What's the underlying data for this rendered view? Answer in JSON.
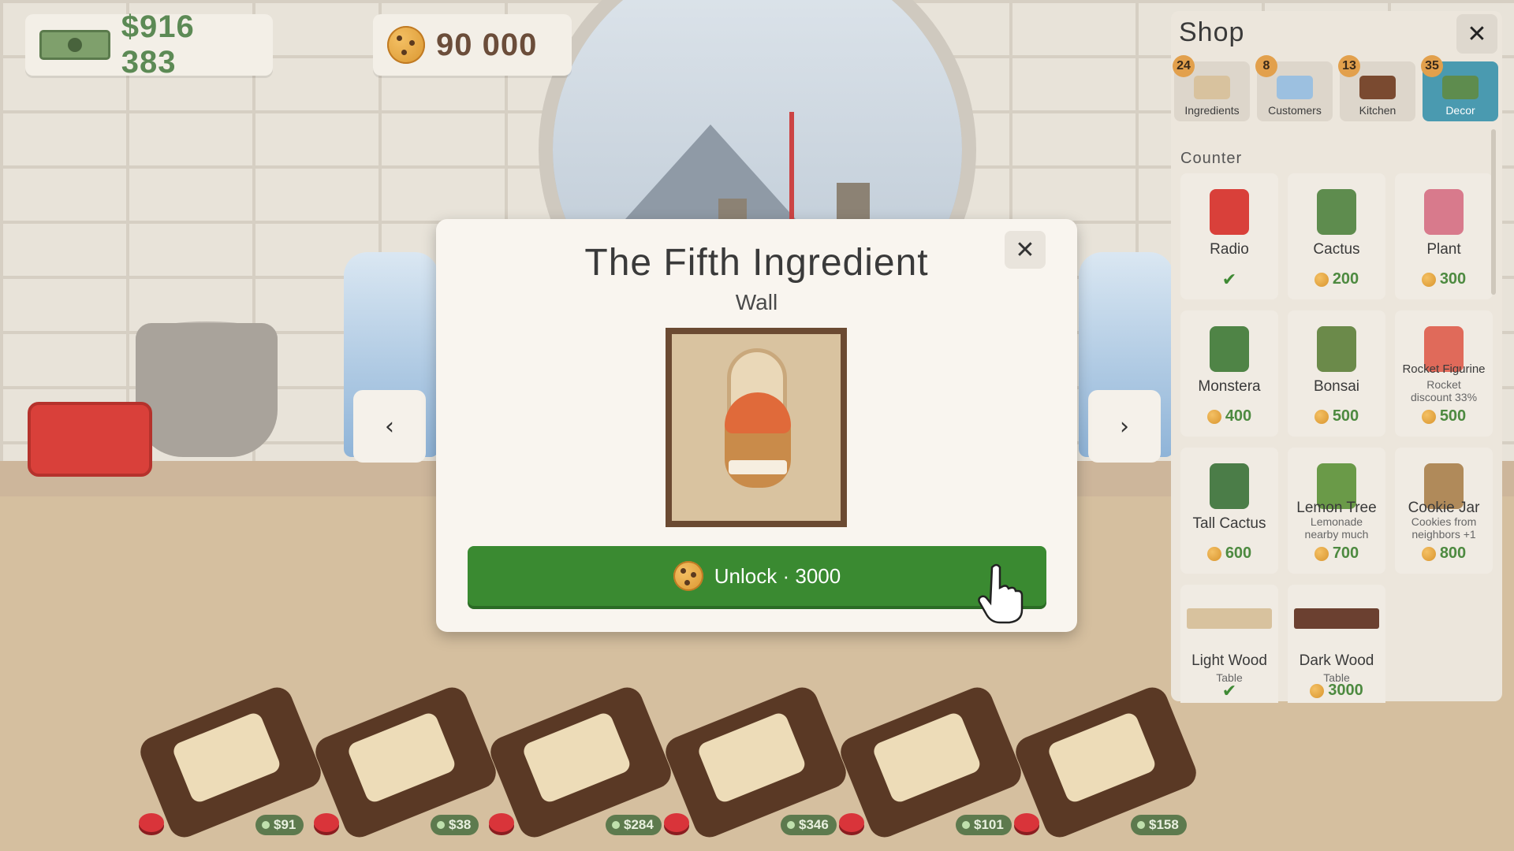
{
  "hud": {
    "cash": "$916 383",
    "cookies": "90 000"
  },
  "modal": {
    "title": "The Fifth Ingredient",
    "subtitle": "Wall",
    "unlock_label": "Unlock · 3000",
    "close_icon": "close-icon"
  },
  "shop": {
    "title": "Shop",
    "tabs": [
      {
        "label": "Ingredients",
        "badge": "24",
        "active": false
      },
      {
        "label": "Customers",
        "badge": "8",
        "active": false
      },
      {
        "label": "Kitchen",
        "badge": "13",
        "active": false
      },
      {
        "label": "Decor",
        "badge": "35",
        "active": true
      }
    ],
    "section": "Counter",
    "items": [
      {
        "name": "Radio",
        "owned": true,
        "color": "#d9403a"
      },
      {
        "name": "Cactus",
        "price": "200",
        "color": "#5e8c4e"
      },
      {
        "name": "Plant",
        "price": "300",
        "color": "#d87a8c"
      },
      {
        "name": "Monstera",
        "price": "400",
        "color": "#4f8446"
      },
      {
        "name": "Bonsai",
        "price": "500",
        "color": "#6b8a4a"
      },
      {
        "name": "Rocket Figurine",
        "desc1": "Rocket",
        "desc2": "discount 33%",
        "price": "500",
        "color": "#e06a5a"
      },
      {
        "name": "Tall Cactus",
        "price": "600",
        "color": "#4b7d48"
      },
      {
        "name": "Lemon Tree",
        "desc1": "Lemonade",
        "desc2": "nearby much",
        "price": "700",
        "color": "#6a9a48"
      },
      {
        "name": "Cookie Jar",
        "desc1": "Cookies from",
        "desc2": "neighbors +1",
        "price": "800",
        "color": "#b08a5a"
      },
      {
        "name": "Light Wood",
        "desc1": "Table",
        "owned": true,
        "color": "#d8c29e"
      },
      {
        "name": "Dark Wood",
        "desc1": "Table",
        "price": "3000",
        "color": "#6b4030"
      }
    ]
  },
  "boards": [
    {
      "price": "$91"
    },
    {
      "price": "$38"
    },
    {
      "price": "$284"
    },
    {
      "price": "$346"
    },
    {
      "price": "$101"
    },
    {
      "price": "$158"
    }
  ]
}
